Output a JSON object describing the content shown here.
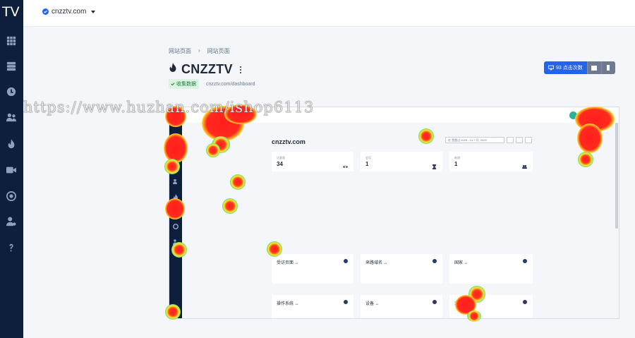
{
  "sidebar": {
    "logo": "TV",
    "icons": [
      "grid-icon",
      "server-icon",
      "clock-icon",
      "users-icon",
      "fire-icon",
      "video-icon",
      "target-icon",
      "user-settings-icon",
      "help-icon"
    ]
  },
  "topbar": {
    "site": "cnzztv.com"
  },
  "page": {
    "breadcrumb": [
      "网站页面",
      "网站页面"
    ],
    "breadcrumb_sep": "›",
    "title": "CNZZTV",
    "badge": "收集数据",
    "url": "cnzztv.com/dashboard"
  },
  "toolbar": {
    "clicks_label": "93 点击次数"
  },
  "watermark": "https://www.huzhan.com/ishop6113",
  "preview": {
    "site_title": "cnzztv.com",
    "date_range": "在 是超过 2025 - 14.7.月, 2025",
    "stats": [
      {
        "label": "访客量",
        "value": "34"
      },
      {
        "label": "会话",
        "value": "1"
      },
      {
        "label": "新增",
        "value": "1"
      }
    ],
    "sections": [
      {
        "title": "受访页面 ↔"
      },
      {
        "title": "来路域名 ↔"
      },
      {
        "title": "国家 ↔"
      },
      {
        "title": "操作系统 ↔"
      },
      {
        "title": "设备 ↔"
      },
      {
        "title": "浏览器 ↔"
      }
    ]
  },
  "colors": {
    "sidebar": "#0e1f3d",
    "accent": "#2463eb",
    "badge_bg": "#dbf4e2",
    "badge_text": "#1f7a3a"
  }
}
